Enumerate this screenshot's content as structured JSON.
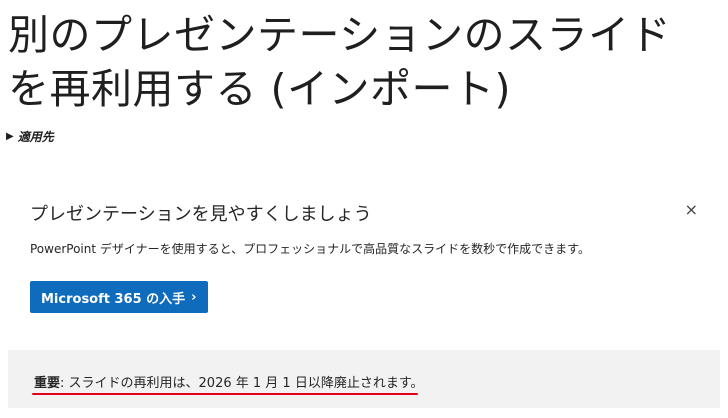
{
  "article": {
    "title_line1": "別のプレゼンテーションのスライド",
    "title_line2": "を再利用する (インポート)",
    "applies_to": "適用先"
  },
  "promo": {
    "title": "プレゼンテーションを見やすくしましょう",
    "description": "PowerPoint デザイナーを使用すると、プロフェッショナルで高品質なスライドを数秒で作成できます。",
    "button_label": "Microsoft 365 の入手",
    "button_chevron": "›",
    "close_glyph": "×"
  },
  "notice": {
    "label": "重要",
    "text": ": スライドの再利用は、2026 年 1 月 1 日以降廃止されます。",
    "annotation_color": "#e2001a"
  },
  "colors": {
    "accent": "#0f6cbd",
    "notice_bg": "#f2f2f2"
  }
}
